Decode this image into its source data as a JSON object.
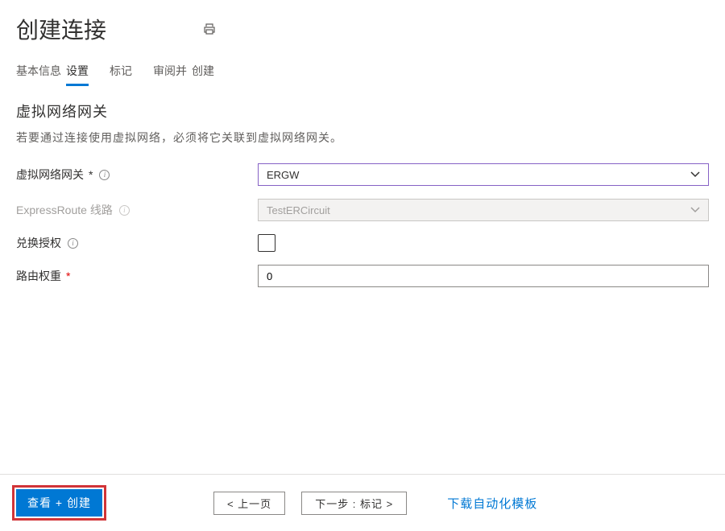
{
  "header": {
    "title": "创建连接"
  },
  "tabs": {
    "basic": "基本信息",
    "settings": "设置",
    "tags": "标记",
    "review_prefix": "审阅并",
    "review_suffix": "创建"
  },
  "section": {
    "title": "虚拟网络网关",
    "desc": "若要通过连接使用虚拟网络，必须将它关联到虚拟网络网关。"
  },
  "form": {
    "gateway_label": "虚拟网络网关",
    "gateway_value": "ERGW",
    "circuit_label": "ExpressRoute 线路",
    "circuit_value": "TestERCircuit",
    "redeem_label": "兑换授权",
    "weight_label": "路由权重",
    "weight_value": "0"
  },
  "footer": {
    "review_create": "查看 + 创建",
    "prev": "< 上一页",
    "next": "下一步 : 标记 >",
    "download": "下载自动化模板"
  }
}
